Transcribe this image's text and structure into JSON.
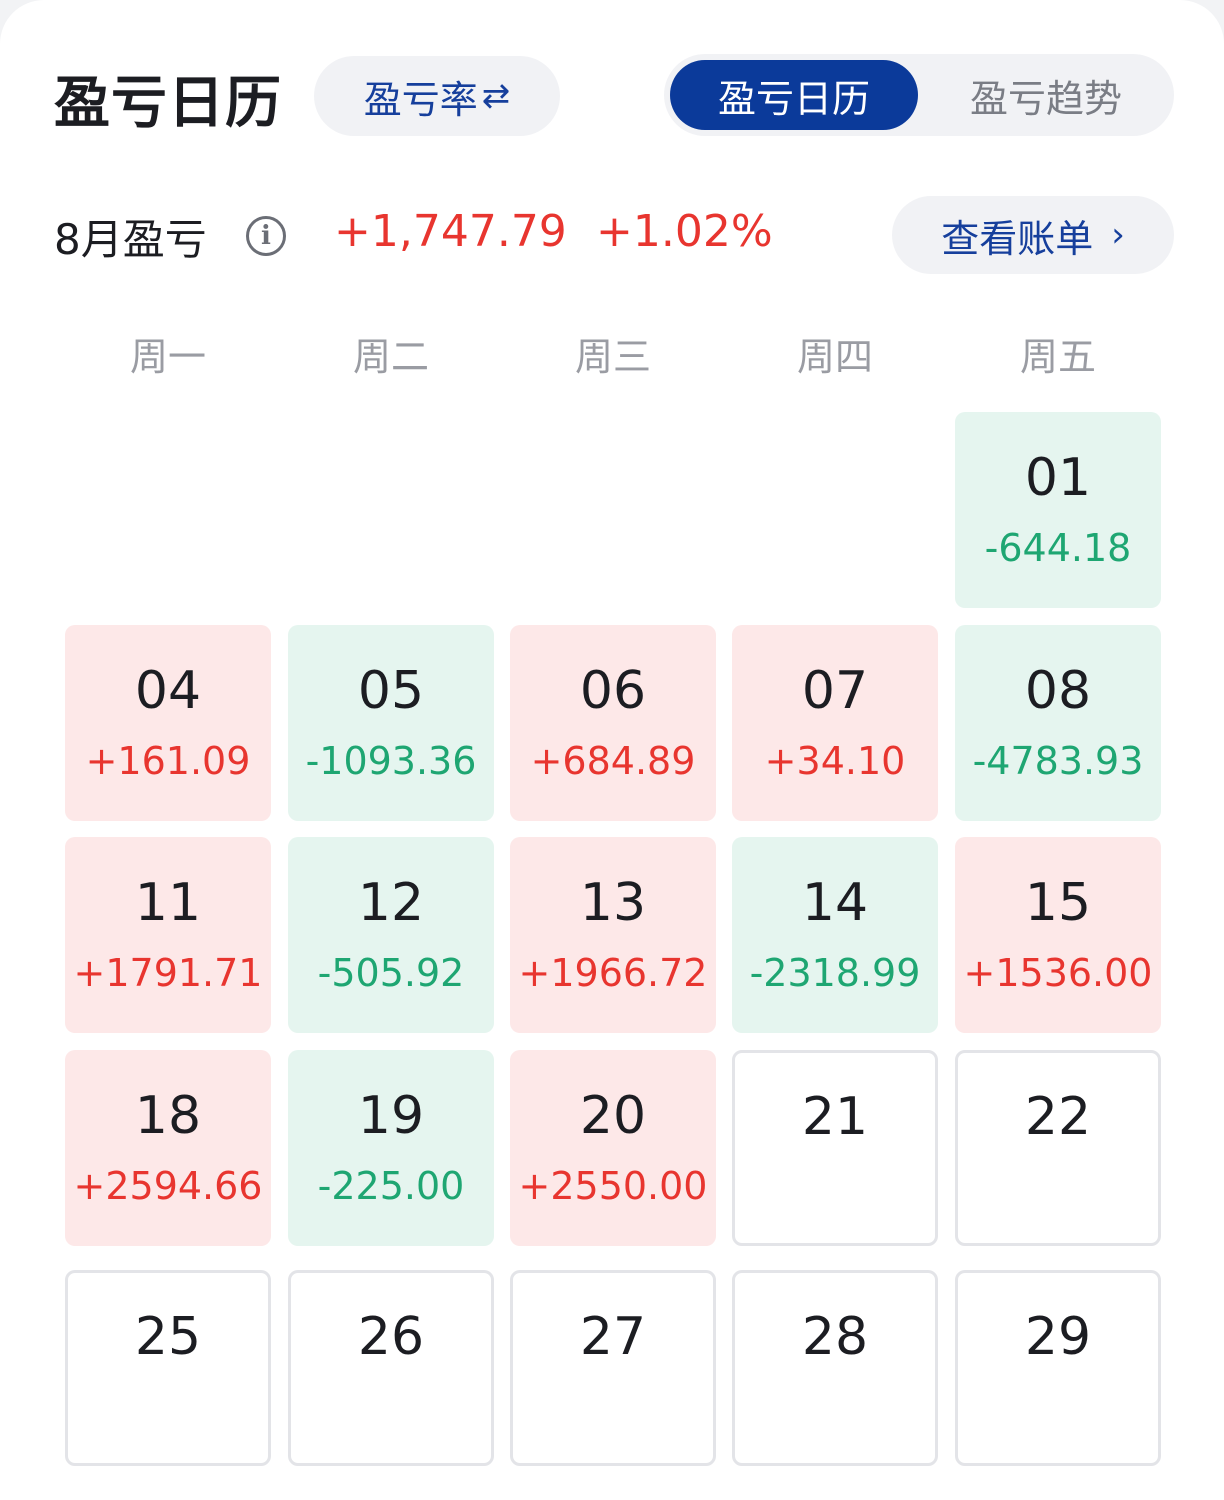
{
  "header": {
    "title": "盈亏日历",
    "rate_toggle_label": "盈亏率",
    "rate_toggle_icon": "swap-arrows-icon",
    "tabs": [
      {
        "label": "盈亏日历",
        "active": true
      },
      {
        "label": "盈亏趋势",
        "active": false
      }
    ]
  },
  "summary": {
    "label": "8月盈亏",
    "info_icon_glyph": "i",
    "amount": "+1,747.79",
    "percent": "+1.02%",
    "view_bill_label": "查看账单",
    "view_bill_chevron": "›"
  },
  "colors": {
    "gain": "#e8352f",
    "loss": "#1ea672",
    "accent": "#0b3a9a"
  },
  "weekdays": [
    "周一",
    "周二",
    "周三",
    "周四",
    "周五"
  ],
  "calendar": {
    "weeks": [
      [
        null,
        null,
        null,
        null,
        {
          "day": "01",
          "pnl": "-644.18",
          "trend": "down"
        }
      ],
      [
        {
          "day": "04",
          "pnl": "+161.09",
          "trend": "up"
        },
        {
          "day": "05",
          "pnl": "-1093.36",
          "trend": "down"
        },
        {
          "day": "06",
          "pnl": "+684.89",
          "trend": "up"
        },
        {
          "day": "07",
          "pnl": "+34.10",
          "trend": "up"
        },
        {
          "day": "08",
          "pnl": "-4783.93",
          "trend": "down"
        }
      ],
      [
        {
          "day": "11",
          "pnl": "+1791.71",
          "trend": "up"
        },
        {
          "day": "12",
          "pnl": "-505.92",
          "trend": "down"
        },
        {
          "day": "13",
          "pnl": "+1966.72",
          "trend": "up"
        },
        {
          "day": "14",
          "pnl": "-2318.99",
          "trend": "down"
        },
        {
          "day": "15",
          "pnl": "+1536.00",
          "trend": "up"
        }
      ],
      [
        {
          "day": "18",
          "pnl": "+2594.66",
          "trend": "up"
        },
        {
          "day": "19",
          "pnl": "-225.00",
          "trend": "down"
        },
        {
          "day": "20",
          "pnl": "+2550.00",
          "trend": "up"
        },
        {
          "day": "21",
          "pnl": "",
          "trend": "none"
        },
        {
          "day": "22",
          "pnl": "",
          "trend": "none"
        }
      ],
      [
        {
          "day": "25",
          "pnl": "",
          "trend": "none"
        },
        {
          "day": "26",
          "pnl": "",
          "trend": "none"
        },
        {
          "day": "27",
          "pnl": "",
          "trend": "none"
        },
        {
          "day": "28",
          "pnl": "",
          "trend": "none"
        },
        {
          "day": "29",
          "pnl": "",
          "trend": "none"
        }
      ]
    ]
  }
}
